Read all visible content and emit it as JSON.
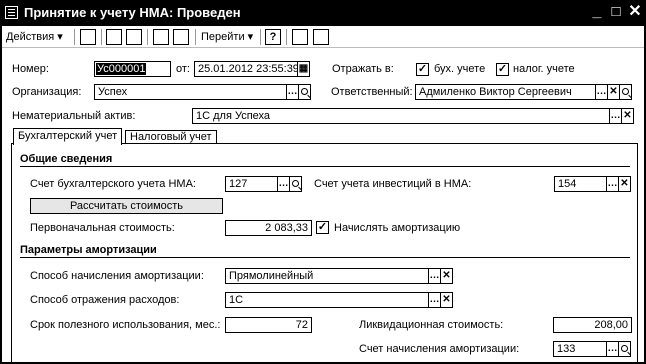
{
  "window": {
    "title": "Принятие к учету НМА: Проведен",
    "minimize": "_",
    "maximize": "□",
    "close": "✕"
  },
  "toolbar": {
    "actions_label": "Действия",
    "goto_label": "Перейти",
    "help_label": "?"
  },
  "header": {
    "number_label": "Номер:",
    "number_value": "Ус000001",
    "date_label": "от:",
    "date_value": "25.01.2012 23:55:39",
    "reflect_label": "Отражать в:",
    "buh_label": "бух. учете",
    "buh_checked": true,
    "nalog_label": "налог. учете",
    "nalog_checked": true,
    "org_label": "Организация:",
    "org_value": "Успех",
    "resp_label": "Ответственный:",
    "resp_value": "Адмиленко Виктор Сергеевич",
    "nma_label": "Нематериальный актив:",
    "nma_value": "1С для Успеха"
  },
  "tabs": [
    {
      "label": "Бухгалтерский учет",
      "active": true
    },
    {
      "label": "Налоговый учет",
      "active": false
    }
  ],
  "general": {
    "title": "Общие сведения",
    "account_label": "Счет бухгалтерского учета НМА:",
    "account_value": "127",
    "invest_label": "Счет учета инвестиций в НМА:",
    "invest_value": "154",
    "calc_button": "Рассчитать стоимость",
    "initial_label": "Первоначальная стоимость:",
    "initial_value": "2 083,33",
    "amort_label": "Начислять амортизацию",
    "amort_checked": true
  },
  "amortization": {
    "title": "Параметры амортизации",
    "method_label": "Способ начисления амортизации:",
    "method_value": "Прямолинейный",
    "expense_label": "Способ отражения расходов:",
    "expense_value": "1С",
    "term_label": "Срок полезного использования, мес.:",
    "term_value": "72",
    "liquid_label": "Ликвидационная стоимость:",
    "liquid_value": "208,00",
    "account_label": "Счет начисления амортизации:",
    "account_value": "133"
  }
}
